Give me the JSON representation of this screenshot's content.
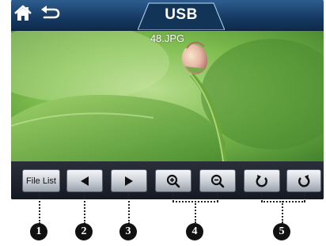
{
  "header": {
    "title": "USB",
    "home_icon": "home-icon",
    "back_icon": "back-arrow-icon"
  },
  "viewer": {
    "filename": "48.JPG"
  },
  "toolbar": {
    "file_list_label": "File List",
    "buttons": [
      {
        "name": "file-list-button",
        "label": "File List"
      },
      {
        "name": "previous-button",
        "icon": "triangle-left-icon"
      },
      {
        "name": "next-button",
        "icon": "triangle-right-icon"
      },
      {
        "name": "zoom-in-button",
        "icon": "zoom-in-icon"
      },
      {
        "name": "zoom-out-button",
        "icon": "zoom-out-icon"
      },
      {
        "name": "rotate-left-button",
        "icon": "rotate-counterclockwise-icon"
      },
      {
        "name": "rotate-right-button",
        "icon": "rotate-clockwise-icon"
      }
    ]
  },
  "callouts": {
    "n1": "1",
    "n2": "2",
    "n3": "3",
    "n4": "4",
    "n5": "5"
  },
  "colors": {
    "header_blue": "#1f4a78",
    "toolbar_dark": "#1b1f28",
    "button_silver": "#d6dae0"
  }
}
